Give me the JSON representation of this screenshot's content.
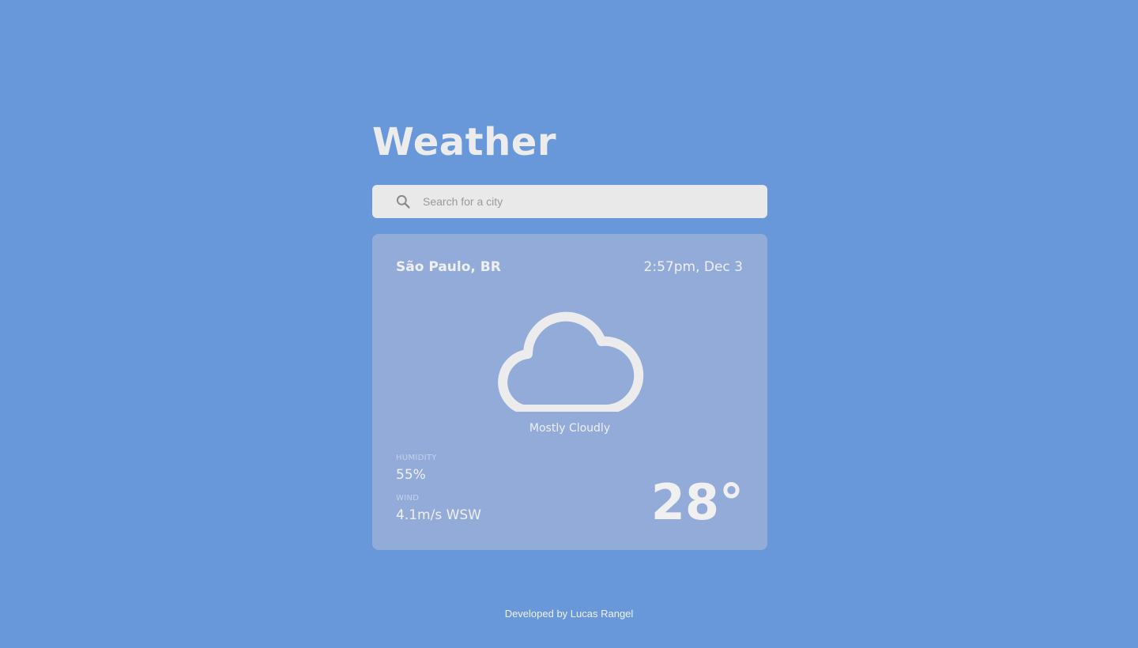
{
  "app": {
    "title": "Weather"
  },
  "search": {
    "placeholder": "Search for a city",
    "value": "",
    "icon": "search-icon"
  },
  "weather": {
    "city": "São Paulo, BR",
    "datetime": "2:57pm, Dec 3",
    "condition_icon": "cloud-icon",
    "condition": "Mostly Cloudly",
    "humidity_label": "HUMIDITY",
    "humidity": "55%",
    "wind_label": "WIND",
    "wind": "4.1m/s WSW",
    "temperature": "28°"
  },
  "footer": {
    "text": "Developed by Lucas Rangel"
  },
  "colors": {
    "background": "#6898d9",
    "card": "#93abd9",
    "search_bg": "#e9e9e9",
    "text": "#ececec"
  }
}
